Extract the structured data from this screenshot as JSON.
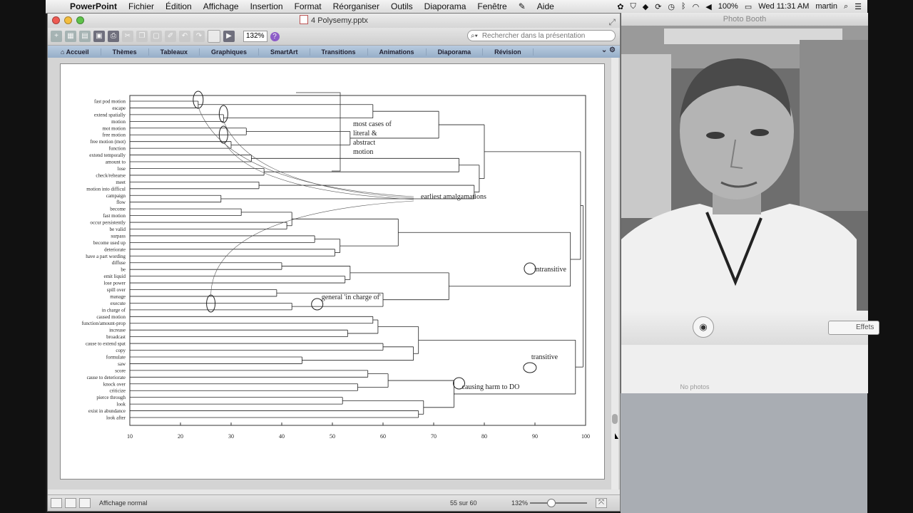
{
  "menubar": {
    "apple": "",
    "app": "PowerPoint",
    "items": [
      "Fichier",
      "Édition",
      "Affichage",
      "Insertion",
      "Format",
      "Réorganiser",
      "Outils",
      "Diaporama",
      "Fenêtre",
      "Aide"
    ],
    "battery": "100%",
    "clock": "Wed 11:31 AM",
    "user": "martin"
  },
  "ppt": {
    "title": "4 Polysemy.pptx",
    "zoom": "132%",
    "search_placeholder": "Rechercher dans la présentation",
    "ribbon_tabs": [
      "Accueil",
      "Thèmes",
      "Tableaux",
      "Graphiques",
      "SmartArt",
      "Transitions",
      "Animations",
      "Diaporama",
      "Révision"
    ],
    "status": {
      "view": "Affichage normal",
      "page": "55 sur 60",
      "zoom": "132%"
    }
  },
  "photobooth": {
    "title": "Photo Booth",
    "effects": "Effets",
    "no_photos": "No photos"
  },
  "chart_data": {
    "type": "dendrogram",
    "leaves": [
      "fast pod motion",
      "escape",
      "extend spatially",
      "motion",
      "mot motion",
      "free motion",
      "free motion (mot)",
      "function",
      "extend temporally",
      "amount to",
      "lose",
      "check/rehearse",
      "meet",
      "motion into difficul",
      "campaign",
      "flow",
      "become",
      "fast motion",
      "occur persistently",
      "be valid",
      "surpass",
      "become used up",
      "deteriorate",
      "have a part wording",
      "diffuse",
      "be",
      "emit liquid",
      "lose power",
      "spill over",
      "manage",
      "execute",
      "in charge of",
      "caused motion",
      "function/amount-prop",
      "increase",
      "broadcast",
      "cause to extend spat",
      "copy",
      "formulate",
      "saw",
      "score",
      "cause to deteriorate",
      "knock over",
      "criticize",
      "pierce through",
      "look",
      "exist in abundance",
      "look after"
    ],
    "x_ticks": [
      10,
      20,
      30,
      40,
      50,
      60,
      70,
      80,
      90,
      100
    ],
    "xlim": [
      10,
      100
    ],
    "annotations": [
      {
        "text": "most cases of literal & abstract motion"
      },
      {
        "text": "earliest amalgamations"
      },
      {
        "text": "intransitive",
        "x": 89
      },
      {
        "text": "general 'in charge of'",
        "x": 47
      },
      {
        "text": "transitive",
        "x": 89
      },
      {
        "text": "causing harm to DO",
        "x": 75
      }
    ]
  }
}
